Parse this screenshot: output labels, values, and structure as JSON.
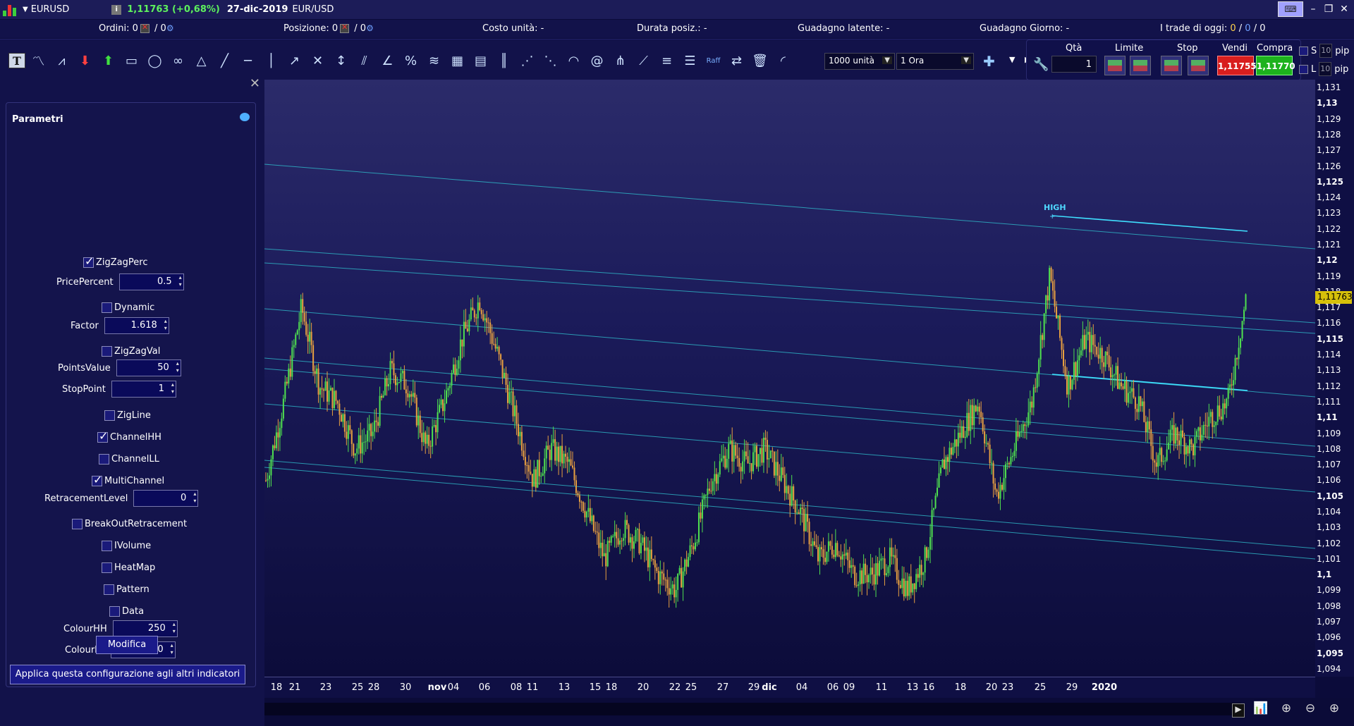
{
  "titlebar": {
    "symbol": "EURUSD",
    "price": "1,11763 (+0,68%)",
    "date": "27-dic-2019",
    "pair": "EUR/USD"
  },
  "stats": {
    "orders_label": "Ordini:",
    "orders_value": "0",
    "orders_sep": "/ 0",
    "position_label": "Posizione:",
    "position_value": "0",
    "position_sep": "/ 0",
    "unit_cost": "Costo unità: -",
    "duration": "Durata posiz.: -",
    "latent_gain": "Guadagno latente: -",
    "day_gain": "Guadagno Giorno: -",
    "trades_label": "I trade di oggi:",
    "trades_a": "0",
    "trades_b": "0",
    "trades_c": "0",
    "sep": "/"
  },
  "toolbar": {
    "units_select": "1000 unità",
    "timeframe_select": "1 Ora",
    "raff_label": "Raff",
    "qty_label": "Qtà",
    "qty_value": "1",
    "limit_label": "Limite",
    "stop_label": "Stop",
    "sell_label": "Vendi",
    "buy_label": "Compra",
    "sell_price": "1,11755",
    "buy_price": "1,11770",
    "s_label": "S",
    "l_label": "L",
    "pip_value": "10",
    "pip_label": "pip"
  },
  "panel": {
    "title": "Parametri",
    "params": [
      {
        "label": "ZigZagPerc",
        "type": "check",
        "checked": true
      },
      {
        "label": "PricePercent",
        "type": "number",
        "value": "0.5"
      },
      {
        "label": "Dynamic",
        "type": "check",
        "checked": false
      },
      {
        "label": "Factor",
        "type": "number",
        "value": "1.618"
      },
      {
        "label": "ZigZagVal",
        "type": "check",
        "checked": false
      },
      {
        "label": "PointsValue",
        "type": "number",
        "value": "50"
      },
      {
        "label": "StopPoint",
        "type": "number",
        "value": "1"
      },
      {
        "label": "ZigLine",
        "type": "check",
        "checked": false
      },
      {
        "label": "ChannelHH",
        "type": "check",
        "checked": true
      },
      {
        "label": "ChannelLL",
        "type": "check",
        "checked": false
      },
      {
        "label": "MultiChannel",
        "type": "check",
        "checked": true
      },
      {
        "label": "RetracementLevel",
        "type": "number",
        "value": "0"
      },
      {
        "label": "BreakOutRetracement",
        "type": "check",
        "checked": false
      },
      {
        "label": "IVolume",
        "type": "check",
        "checked": false
      },
      {
        "label": "HeatMap",
        "type": "check",
        "checked": false
      },
      {
        "label": "Pattern",
        "type": "check",
        "checked": false
      },
      {
        "label": "Data",
        "type": "check",
        "checked": false
      },
      {
        "label": "ColourHH",
        "type": "number",
        "value": "250"
      },
      {
        "label": "ColourLL",
        "type": "number",
        "value": "250"
      }
    ],
    "modify_button": "Modifica",
    "apply_button": "Applica questa configurazione agli altri indicatori"
  },
  "chart_data": {
    "type": "candlestick",
    "symbol": "EURUSD",
    "timeframe": "1 Ora",
    "last_price": "1,11763",
    "annotation": "HIGH",
    "y_ticks": [
      "1,131",
      "1,13",
      "1,129",
      "1,128",
      "1,127",
      "1,126",
      "1,125",
      "1,124",
      "1,123",
      "1,122",
      "1,121",
      "1,12",
      "1,119",
      "1,118",
      "1,117",
      "1,116",
      "1,115",
      "1,114",
      "1,113",
      "1,112",
      "1,111",
      "1,11",
      "1,109",
      "1,108",
      "1,107",
      "1,106",
      "1,105",
      "1,104",
      "1,103",
      "1,102",
      "1,101",
      "1,1",
      "1,099",
      "1,098",
      "1,097",
      "1,096",
      "1,095",
      "1,094"
    ],
    "y_bold": [
      "1,13",
      "1,125",
      "1,12",
      "1,115",
      "1,11",
      "1,105",
      "1,1",
      "1,095"
    ],
    "ylim": [
      1.0935,
      1.1315
    ],
    "x_ticks": [
      "18",
      "21",
      "23",
      "25",
      "28",
      "30",
      "nov",
      "04",
      "06",
      "08",
      "11",
      "13",
      "15",
      "18",
      "20",
      "22",
      "25",
      "27",
      "29",
      "dic",
      "04",
      "06",
      "09",
      "11",
      "13",
      "16",
      "18",
      "20",
      "23",
      "25",
      "29",
      "2020"
    ],
    "x_bold": [
      "nov",
      "dic",
      "2020"
    ],
    "price_path": [
      1.106,
      1.111,
      1.117,
      1.112,
      1.111,
      1.108,
      1.109,
      1.113,
      1.112,
      1.108,
      1.111,
      1.115,
      1.1175,
      1.114,
      1.11,
      1.106,
      1.108,
      1.107,
      1.104,
      1.101,
      1.103,
      1.102,
      1.1,
      1.099,
      1.102,
      1.106,
      1.108,
      1.107,
      1.108,
      1.106,
      1.104,
      1.101,
      1.102,
      1.1,
      1.1,
      1.101,
      1.099,
      1.101,
      1.107,
      1.109,
      1.111,
      1.105,
      1.108,
      1.111,
      1.119,
      1.112,
      1.115,
      1.114,
      1.112,
      1.111,
      1.107,
      1.109,
      1.108,
      1.11,
      1.111,
      1.1175
    ]
  }
}
